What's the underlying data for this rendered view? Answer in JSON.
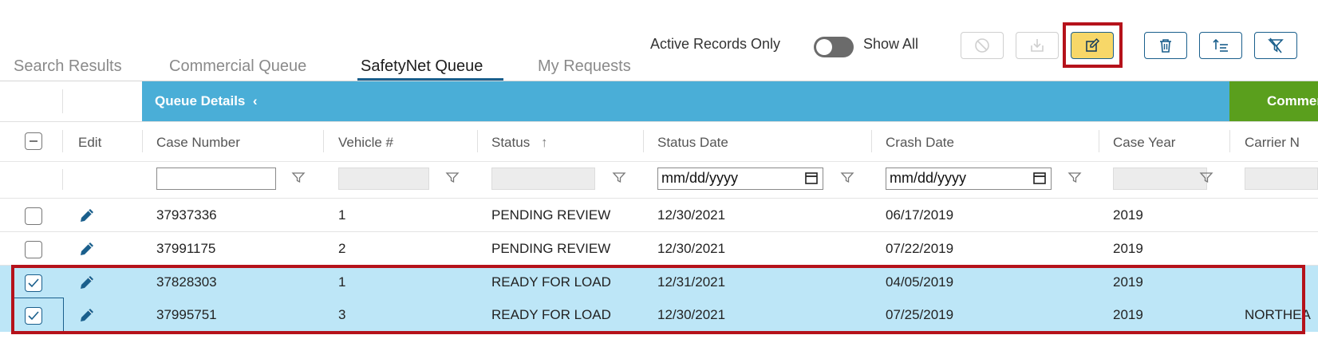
{
  "tabs": [
    {
      "label": "Search Results",
      "active": false
    },
    {
      "label": "Commercial Queue",
      "active": false
    },
    {
      "label": "SafetyNet Queue",
      "active": true
    },
    {
      "label": "My Requests",
      "active": false
    }
  ],
  "toolbar": {
    "active_only_label": "Active Records Only",
    "show_all_label": "Show All",
    "toggle_state": "Active Records Only",
    "buttons": [
      {
        "name": "cancel",
        "icon": "cancel-icon",
        "disabled": true
      },
      {
        "name": "export",
        "icon": "download-icon",
        "disabled": true
      },
      {
        "name": "edit",
        "icon": "edit-icon",
        "active": true
      },
      {
        "name": "delete",
        "icon": "trash-icon"
      },
      {
        "name": "sort",
        "icon": "sort-list-icon"
      },
      {
        "name": "clear-filter",
        "icon": "clear-filter-icon"
      }
    ]
  },
  "group_headers": {
    "queue_details": "Queue Details",
    "commercial": "Commerc"
  },
  "columns": {
    "edit": "Edit",
    "case_number": "Case Number",
    "vehicle": "Vehicle #",
    "status": "Status",
    "status_sort": "↑",
    "status_date": "Status Date",
    "crash_date": "Crash Date",
    "case_year": "Case Year",
    "carrier": "Carrier N"
  },
  "filters": {
    "date_placeholder": "mm/dd/yyyy",
    "case_number_value": ""
  },
  "rows": [
    {
      "checked": false,
      "case_number": "37937336",
      "vehicle": "1",
      "status": "PENDING REVIEW",
      "status_date": "12/30/2021",
      "crash_date": "06/17/2019",
      "case_year": "2019",
      "carrier": ""
    },
    {
      "checked": false,
      "case_number": "37991175",
      "vehicle": "2",
      "status": "PENDING REVIEW",
      "status_date": "12/30/2021",
      "crash_date": "07/22/2019",
      "case_year": "2019",
      "carrier": ""
    },
    {
      "checked": true,
      "case_number": "37828303",
      "vehicle": "1",
      "status": "READY FOR LOAD",
      "status_date": "12/31/2021",
      "crash_date": "04/05/2019",
      "case_year": "2019",
      "carrier": ""
    },
    {
      "checked": true,
      "case_number": "37995751",
      "vehicle": "3",
      "status": "READY FOR LOAD",
      "status_date": "12/30/2021",
      "crash_date": "07/25/2019",
      "case_year": "2019",
      "carrier": "NORTHEA"
    }
  ],
  "colors": {
    "queue_header": "#4aaed7",
    "commercial_header": "#5a9f1d",
    "selected_row": "#bde6f7",
    "highlight": "#b5121b",
    "accent": "#1a5f8c",
    "edit_active": "#f7d768"
  }
}
